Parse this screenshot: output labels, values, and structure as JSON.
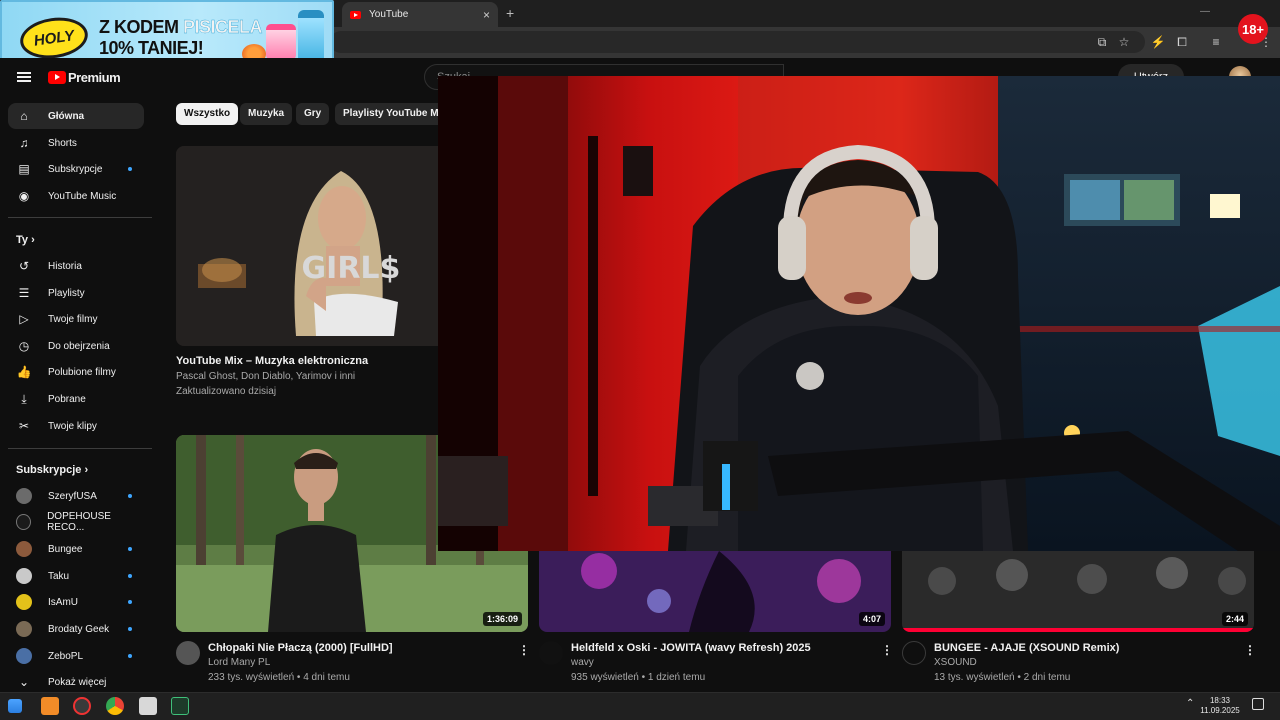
{
  "browser": {
    "tab_title": "YouTube",
    "tab_close": "×",
    "new_tab": "+",
    "window_controls": [
      "—",
      "❐",
      "✕"
    ]
  },
  "ad": {
    "brand": "HOLY",
    "line1_prefix": "Z KODEM ",
    "line1_code": "PISICELA",
    "line2": "10% TANIEJ!"
  },
  "age_badge": "18+",
  "masthead": {
    "logo_text": "Premium",
    "search_placeholder": "Szukaj",
    "create_label": "Utwórz"
  },
  "sidebar": {
    "main": [
      {
        "label": "Główna",
        "icon": "home-icon",
        "glyph": "⌂"
      },
      {
        "label": "Shorts",
        "icon": "shorts-icon",
        "glyph": "♫"
      },
      {
        "label": "Subskrypcje",
        "icon": "subscriptions-icon",
        "glyph": "▤"
      },
      {
        "label": "YouTube Music",
        "icon": "youtube-music-icon",
        "glyph": "◉"
      }
    ],
    "you_heading": "Ty",
    "you": [
      {
        "label": "Historia",
        "icon": "history-icon",
        "glyph": "↺"
      },
      {
        "label": "Playlisty",
        "icon": "playlists-icon",
        "glyph": "☰"
      },
      {
        "label": "Twoje filmy",
        "icon": "your-videos-icon",
        "glyph": "▷"
      },
      {
        "label": "Do obejrzenia",
        "icon": "watch-later-icon",
        "glyph": "◷"
      },
      {
        "label": "Polubione filmy",
        "icon": "liked-videos-icon",
        "glyph": "👍"
      },
      {
        "label": "Pobrane",
        "icon": "downloads-icon",
        "glyph": "⤓"
      },
      {
        "label": "Twoje klipy",
        "icon": "clips-icon",
        "glyph": "✂"
      }
    ],
    "subs_heading": "Subskrypcje",
    "subs": [
      {
        "label": "SzeryfUSA",
        "color": "#6b6b6b"
      },
      {
        "label": "DOPEHOUSE RECO...",
        "color": "#1a1a1a"
      },
      {
        "label": "Bungee",
        "color": "#8c5a3c"
      },
      {
        "label": "Taku",
        "color": "#c9c9c9"
      },
      {
        "label": "IsAmU",
        "color": "#e3c21a"
      },
      {
        "label": "Brodaty Geek",
        "color": "#7a6a55"
      },
      {
        "label": "ZeboPL",
        "color": "#4a6fa5"
      }
    ],
    "show_more": "Pokaż więcej"
  },
  "chips": [
    "Wszystko",
    "Muzyka",
    "Gry",
    "Playlisty YouTube Mix"
  ],
  "videos": {
    "mix": {
      "thumb_text": "GIRL$",
      "title": "YouTube Mix – Muzyka elektroniczna",
      "channels": "Pascal Ghost, Don Diablo, Yarimov i inni",
      "updated": "Zaktualizowano dzisiaj"
    },
    "row2": [
      {
        "title": "Chłopaki Nie Płaczą (2000) [FullHD]",
        "channel": "Lord Many PL",
        "stats": "233 tys. wyświetleń • 4 dni temu",
        "duration": "1:36:09"
      },
      {
        "title": "Heldfeld x Oski - JOWITA (wavy Refresh) 2025",
        "channel": "wavy",
        "stats": "935 wyświetleń • 1 dzień temu",
        "duration": "4:07"
      },
      {
        "title": "BUNGEE - AJAJE (XSOUND Remix)",
        "channel": "XSOUND",
        "stats": "13 tys. wyświetleń • 2 dni temu",
        "duration": "2:44"
      }
    ]
  },
  "taskbar": {
    "time": "18:33",
    "date": "11.09.2025"
  }
}
